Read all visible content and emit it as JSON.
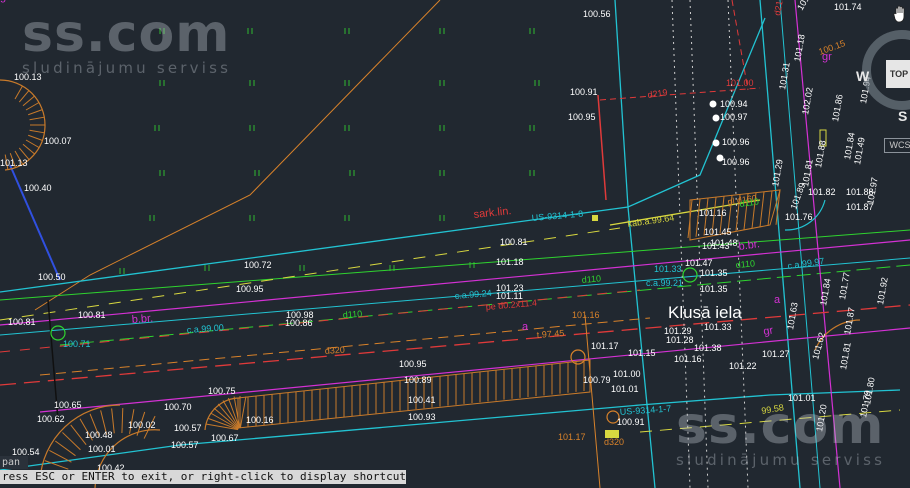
{
  "watermarks": [
    {
      "brand": "ss.com",
      "tagline": "sludinājumu serviss"
    },
    {
      "brand": "ss.com",
      "tagline": "sludinājumu serviss"
    }
  ],
  "command_line": {
    "text": "ress ESC or ENTER to exit, or right-click to display shortcut menu.",
    "mode_tab": "pan"
  },
  "viewcube": {
    "face": "TOP",
    "west": "W",
    "south": "S",
    "wcs": "WCS"
  },
  "street_name": "Klusā iela",
  "colors": {
    "background": "#212830",
    "boundary": "#22c3d2",
    "red_dash": "#e03a3a",
    "magenta": "#d431d4",
    "orange": "#d8822a",
    "green": "#2fd42f",
    "yellow": "#d8d840",
    "white": "#ffffff"
  },
  "labels": [
    {
      "text": "100.56",
      "color": "white"
    },
    {
      "text": "100.13",
      "color": "white"
    },
    {
      "text": "100.07",
      "color": "white"
    },
    {
      "text": "100.40",
      "color": "white"
    },
    {
      "text": "100.50",
      "color": "white"
    },
    {
      "text": "100.81",
      "color": "white"
    },
    {
      "text": "100.81",
      "color": "white"
    },
    {
      "text": "100.71",
      "color": "cyan"
    },
    {
      "text": "100.72",
      "color": "white"
    },
    {
      "text": "100.95",
      "color": "white"
    },
    {
      "text": "100.98",
      "color": "white"
    },
    {
      "text": "100.86",
      "color": "white"
    },
    {
      "text": "b.br.",
      "color": "magenta"
    },
    {
      "text": "c.a.99.00",
      "color": "cyan"
    },
    {
      "text": "d110",
      "color": "green"
    },
    {
      "text": "d320",
      "color": "orange"
    },
    {
      "text": "sark.lin.",
      "color": "red"
    },
    {
      "text": "US-9314-1-8",
      "color": "cyan"
    },
    {
      "text": "100.81",
      "color": "white"
    },
    {
      "text": "101.18",
      "color": "white"
    },
    {
      "text": "101.23",
      "color": "white"
    },
    {
      "text": "101.11",
      "color": "white"
    },
    {
      "text": "c.a.99.24",
      "color": "cyan"
    },
    {
      "text": "pe d0.2x11.4",
      "color": "red"
    },
    {
      "text": "d110",
      "color": "green"
    },
    {
      "text": "t.97.45",
      "color": "orange"
    },
    {
      "text": "101.16",
      "color": "orange"
    },
    {
      "text": "a",
      "color": "magenta"
    },
    {
      "text": "101.17",
      "color": "white"
    },
    {
      "text": "101.15",
      "color": "white"
    },
    {
      "text": "101.00",
      "color": "white"
    },
    {
      "text": "101.01",
      "color": "white"
    },
    {
      "text": "100.79",
      "color": "white"
    },
    {
      "text": "100.91",
      "color": "white"
    },
    {
      "text": "US-9314-1-7",
      "color": "cyan"
    },
    {
      "text": "101.17",
      "color": "orange"
    },
    {
      "text": "d320",
      "color": "orange"
    },
    {
      "text": "100.95",
      "color": "white"
    },
    {
      "text": "100.89",
      "color": "white"
    },
    {
      "text": "100.41",
      "color": "white"
    },
    {
      "text": "100.93",
      "color": "white"
    },
    {
      "text": "100.75",
      "color": "white"
    },
    {
      "text": "100.16",
      "color": "white"
    },
    {
      "text": "100.67",
      "color": "white"
    },
    {
      "text": "100.70",
      "color": "white"
    },
    {
      "text": "100.57",
      "color": "white"
    },
    {
      "text": "100.57",
      "color": "white"
    },
    {
      "text": "100.02",
      "color": "white"
    },
    {
      "text": "100.65",
      "color": "white"
    },
    {
      "text": "100.62",
      "color": "white"
    },
    {
      "text": "100.48",
      "color": "white"
    },
    {
      "text": "100.01",
      "color": "white"
    },
    {
      "text": "100.54",
      "color": "white"
    },
    {
      "text": "100.42",
      "color": "white"
    },
    {
      "text": "100.91",
      "color": "white"
    },
    {
      "text": "100.95",
      "color": "white"
    },
    {
      "text": "d219",
      "color": "red"
    },
    {
      "text": "101.00",
      "color": "red"
    },
    {
      "text": "100.94",
      "color": "white"
    },
    {
      "text": "100.97",
      "color": "white"
    },
    {
      "text": "100.96",
      "color": "white"
    },
    {
      "text": "100.96",
      "color": "white"
    },
    {
      "text": "kab.a.99.64",
      "color": "yellow"
    },
    {
      "text": "pl d160",
      "color": "orange"
    },
    {
      "text": "101.16",
      "color": "white"
    },
    {
      "text": "101.45",
      "color": "white"
    },
    {
      "text": "101.43",
      "color": "white"
    },
    {
      "text": "101.48",
      "color": "white"
    },
    {
      "text": "b.br.",
      "color": "magenta"
    },
    {
      "text": "101.47",
      "color": "white"
    },
    {
      "text": "101.33",
      "color": "cyan"
    },
    {
      "text": "101.35",
      "color": "white"
    },
    {
      "text": "d110",
      "color": "green"
    },
    {
      "text": "c.a.99.21",
      "color": "cyan"
    },
    {
      "text": "101.35",
      "color": "white"
    },
    {
      "text": "c.a.99.97",
      "color": "cyan"
    },
    {
      "text": "101.29",
      "color": "white"
    },
    {
      "text": "101.28",
      "color": "white"
    },
    {
      "text": "101.33",
      "color": "white"
    },
    {
      "text": "101.38",
      "color": "white"
    },
    {
      "text": "101.16",
      "color": "white"
    },
    {
      "text": "101.22",
      "color": "white"
    },
    {
      "text": "101.27",
      "color": "white"
    },
    {
      "text": "gr",
      "color": "magenta"
    },
    {
      "text": "a",
      "color": "magenta"
    },
    {
      "text": "101.76",
      "color": "white"
    },
    {
      "text": "101.89",
      "color": "white"
    },
    {
      "text": "101.88",
      "color": "white"
    },
    {
      "text": "101.87",
      "color": "white"
    },
    {
      "text": "101.01",
      "color": "white"
    },
    {
      "text": "99.58",
      "color": "yellow"
    },
    {
      "text": "101.62",
      "color": "white"
    },
    {
      "text": "101.63",
      "color": "white"
    },
    {
      "text": "101.82",
      "color": "white"
    },
    {
      "text": "101.84",
      "color": "white"
    },
    {
      "text": "101.20",
      "color": "white"
    },
    {
      "text": "gr",
      "color": "magenta"
    },
    {
      "text": "101.79",
      "color": "white"
    },
    {
      "text": "101.80",
      "color": "white"
    },
    {
      "text": "101.87",
      "color": "white"
    },
    {
      "text": "101.92",
      "color": "white"
    },
    {
      "text": "101.97",
      "color": "white"
    },
    {
      "text": "101.84",
      "color": "white"
    },
    {
      "text": "101.88",
      "color": "white"
    },
    {
      "text": "101.81",
      "color": "white"
    },
    {
      "text": "101.29",
      "color": "white"
    },
    {
      "text": "101.31",
      "color": "white"
    },
    {
      "text": "101.86",
      "color": "white"
    },
    {
      "text": "101.94",
      "color": "white"
    },
    {
      "text": "102.02",
      "color": "white"
    },
    {
      "text": "101.18",
      "color": "white"
    },
    {
      "text": "101.49",
      "color": "white"
    },
    {
      "text": "101.81",
      "color": "white"
    },
    {
      "text": "101.77",
      "color": "white"
    },
    {
      "text": "101.69",
      "color": "white"
    },
    {
      "text": "101.74",
      "color": "white"
    },
    {
      "text": "d219",
      "color": "red"
    },
    {
      "text": "d110",
      "color": "green"
    },
    {
      "text": "101.13",
      "color": "white"
    },
    {
      "text": "100.15",
      "color": "orange"
    },
    {
      "text": "5",
      "color": "white"
    },
    {
      "text": "gr",
      "color": "magenta"
    }
  ]
}
